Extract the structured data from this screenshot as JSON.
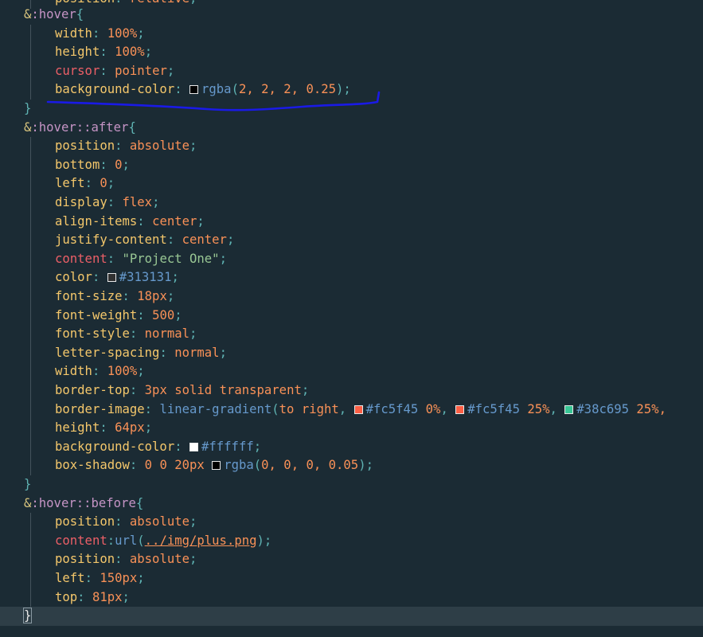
{
  "editor": {
    "theme_colors": {
      "background": "#1b2b34",
      "current_line": "#2e3e47",
      "annotation_stroke": "#1a1ae6"
    },
    "top_partial": "position: relative;",
    "lines": [
      {
        "selector": "&:hover",
        "brace": "{"
      },
      {
        "prop": "width",
        "value": "100%"
      },
      {
        "prop": "height",
        "value": "100%"
      },
      {
        "prop": "cursor",
        "value": "pointer"
      },
      {
        "prop": "background-color",
        "fn": "rgba",
        "args": "2, 2, 2, 0.25",
        "swatch": "#020202"
      },
      {
        "close": "}"
      },
      {
        "selector": "&:hover::after",
        "brace": "{"
      },
      {
        "prop": "position",
        "value": "absolute"
      },
      {
        "prop": "bottom",
        "value": "0"
      },
      {
        "prop": "left",
        "value": "0"
      },
      {
        "prop": "display",
        "value": "flex"
      },
      {
        "prop": "align-items",
        "value": "center"
      },
      {
        "prop": "justify-content",
        "value": "center"
      },
      {
        "prop": "content",
        "string": "\"Project One\""
      },
      {
        "prop": "color",
        "hex": "#313131",
        "swatch": "#313131"
      },
      {
        "prop": "font-size",
        "value": "18px"
      },
      {
        "prop": "font-weight",
        "value": "500"
      },
      {
        "prop": "font-style",
        "value": "normal"
      },
      {
        "prop": "letter-spacing",
        "value": "normal"
      },
      {
        "prop": "width",
        "value": "100%"
      },
      {
        "prop": "border-top",
        "value": "3px solid transparent"
      },
      {
        "prop": "border-image",
        "gradient": {
          "fn": "linear-gradient",
          "dir": "to right",
          "stops": [
            {
              "color": "#fc5f45",
              "pos": "0%"
            },
            {
              "color": "#fc5f45",
              "pos": "25%"
            },
            {
              "color": "#38c695",
              "pos": "25%,"
            }
          ]
        }
      },
      {
        "prop": "height",
        "value": "64px"
      },
      {
        "prop": "background-color",
        "hex": "#ffffff",
        "swatch": "#ffffff"
      },
      {
        "prop": "box-shadow",
        "value": "0 0 20px",
        "fn": "rgba",
        "args": "0, 0, 0, 0.05",
        "swatch": "#000000"
      },
      {
        "close": "}"
      },
      {
        "selector": "&:hover::before",
        "brace": "{"
      },
      {
        "prop": "position",
        "value": "absolute"
      },
      {
        "prop": "content",
        "url": "../img/plus.png"
      },
      {
        "prop": "position",
        "value": "absolute"
      },
      {
        "prop": "left",
        "value": "150px"
      },
      {
        "prop": "top",
        "value": "81px"
      },
      {
        "close": "}",
        "current": true
      }
    ]
  }
}
